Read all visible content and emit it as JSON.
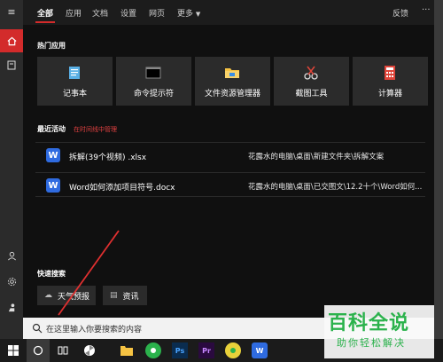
{
  "tabs": [
    {
      "label": "全部"
    },
    {
      "label": "应用"
    },
    {
      "label": "文档"
    },
    {
      "label": "设置"
    },
    {
      "label": "网页"
    },
    {
      "label": "更多"
    }
  ],
  "top_right": {
    "feedback": "反馈",
    "more": "···"
  },
  "hot_apps": {
    "title": "热门应用",
    "apps": [
      {
        "label": "记事本",
        "icon": "notepad-icon"
      },
      {
        "label": "命令提示符",
        "icon": "cmd-icon"
      },
      {
        "label": "文件资源管理器",
        "icon": "folder-icon"
      },
      {
        "label": "截图工具",
        "icon": "snipping-icon"
      },
      {
        "label": "计算器",
        "icon": "calculator-icon"
      }
    ]
  },
  "recent": {
    "title": "最近活动",
    "manage_link": "在时间线中管理",
    "items": [
      {
        "name": "拆解(39个视频) .xlsx",
        "path": "花露水的电脑\\桌面\\新建文件夹\\拆解文案"
      },
      {
        "name": "Word如何添加项目符号.docx",
        "path": "花露水的电脑\\桌面\\已交图文\\12.2十个\\Word如何..."
      }
    ]
  },
  "quick_search": {
    "title": "快速搜索",
    "items": [
      {
        "label": "天气预报",
        "icon": "cloud-icon"
      },
      {
        "label": "资讯",
        "icon": "news-icon"
      }
    ]
  },
  "search": {
    "placeholder": "在这里输入你要搜索的内容"
  },
  "watermark": {
    "big": "百科全说",
    "small": "助你轻松解决"
  },
  "colors": {
    "accent": "#d32b2b",
    "panel": "#101010",
    "card": "#2b2b2b",
    "watermark": "#2bb24c"
  }
}
